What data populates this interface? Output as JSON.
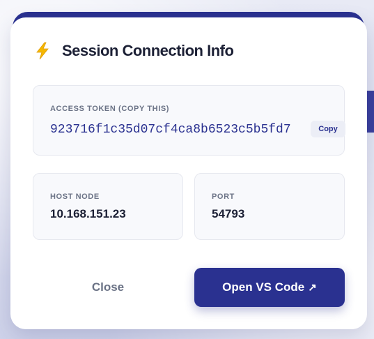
{
  "modal": {
    "title": "Session Connection Info",
    "title_icon": "lightning-bolt-icon"
  },
  "token": {
    "label": "ACCESS TOKEN (COPY THIS)",
    "value": "923716f1c35d07cf4ca8b6523c5b5fd7",
    "copy_label": "Copy"
  },
  "host": {
    "label": "HOST NODE",
    "value": "10.168.151.23"
  },
  "port": {
    "label": "PORT",
    "value": "54793"
  },
  "actions": {
    "close_label": "Close",
    "open_label": "Open VS Code",
    "open_icon": "external-link-arrow-icon",
    "arrow_glyph": "↗"
  },
  "colors": {
    "accent": "#2a3190",
    "bolt": "#f5b800"
  }
}
